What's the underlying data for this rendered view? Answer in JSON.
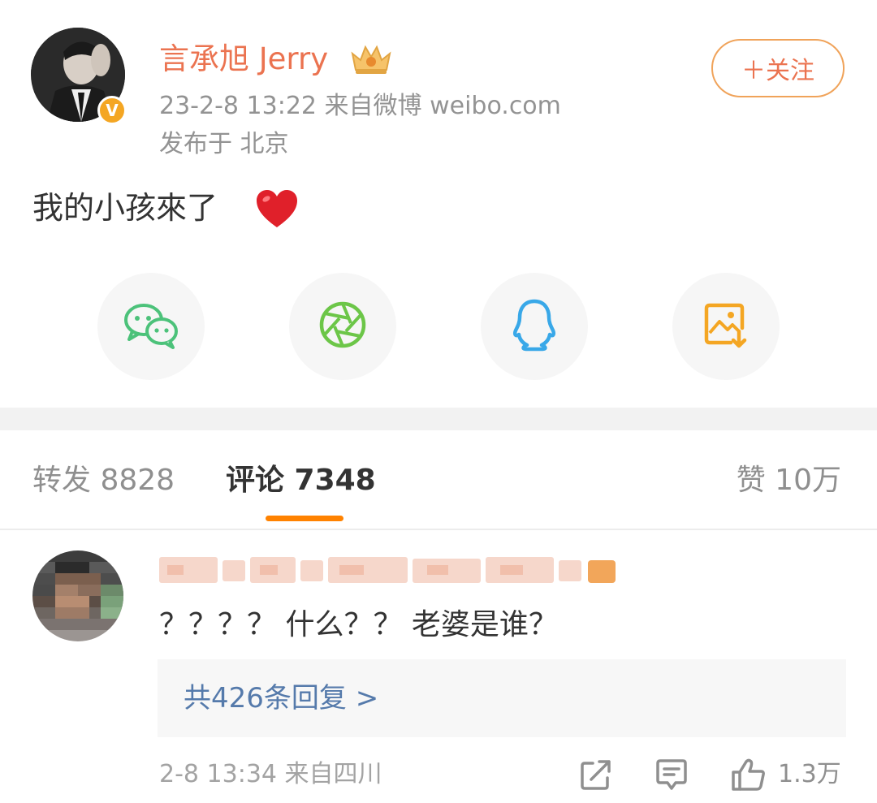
{
  "post": {
    "user_name": "言承旭 Jerry",
    "verified_badge": "V",
    "timestamp": "23-2-8 13:22",
    "source": "来自微博 weibo.com",
    "location": "发布于 北京",
    "follow_label": "＋关注",
    "text": "我的小孩來了",
    "emoji_icon": "red-heart-icon"
  },
  "share": {
    "items": [
      {
        "icon": "wechat-icon",
        "color": "#4cc27a"
      },
      {
        "icon": "moments-icon",
        "color": "#6cc648"
      },
      {
        "icon": "qq-icon",
        "color": "#39a8e8"
      },
      {
        "icon": "save-image-icon",
        "color": "#f4a623"
      }
    ]
  },
  "tabs": {
    "repost": "转发 8828",
    "comments": "评论 7348",
    "likes": "赞 10万",
    "active_color": "#ff8200"
  },
  "comment": {
    "text": "？？？？ 什么？？ 老婆是谁？",
    "replies_link": "共426条回复 >",
    "time": "2-8 13:34 来自四川",
    "like_count": "1.3万"
  }
}
